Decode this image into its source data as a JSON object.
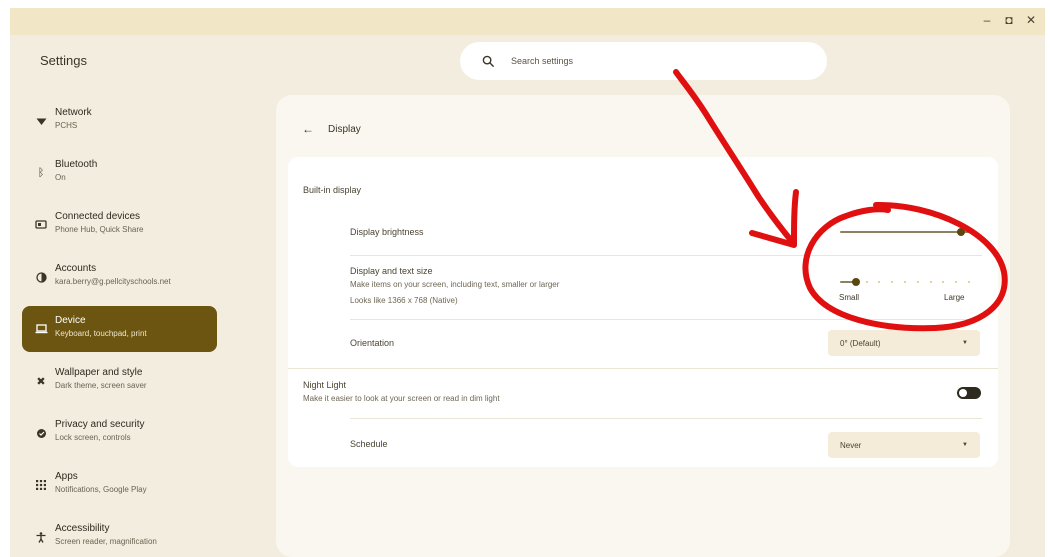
{
  "window": {
    "controls": [
      "–",
      "◘",
      "✕"
    ]
  },
  "app": {
    "title": "Settings"
  },
  "search": {
    "placeholder": "Search settings"
  },
  "sidebar": {
    "items": [
      {
        "label": "Network",
        "sub": "PCHS",
        "icon": "wifi-icon"
      },
      {
        "label": "Bluetooth",
        "sub": "On",
        "icon": "bluetooth-icon"
      },
      {
        "label": "Connected devices",
        "sub": "Phone Hub, Quick Share",
        "icon": "devices-icon"
      },
      {
        "label": "Accounts",
        "sub": "kara.berry@g.pellcityschools.net",
        "icon": "account-icon"
      },
      {
        "label": "Device",
        "sub": "Keyboard, touchpad, print",
        "icon": "laptop-icon",
        "active": true
      },
      {
        "label": "Wallpaper and style",
        "sub": "Dark theme, screen saver",
        "icon": "palette-icon"
      },
      {
        "label": "Privacy and security",
        "sub": "Lock screen, controls",
        "icon": "shield-icon"
      },
      {
        "label": "Apps",
        "sub": "Notifications, Google Play",
        "icon": "apps-icon"
      },
      {
        "label": "Accessibility",
        "sub": "Screen reader, magnification",
        "icon": "accessibility-icon"
      }
    ]
  },
  "page": {
    "title": "Display",
    "built_in": {
      "section": "Built-in display",
      "brightness": {
        "label": "Display brightness",
        "level": 0.96
      },
      "size": {
        "label": "Display and text size",
        "desc": "Make items on your screen, including text, smaller or larger",
        "native": "Looks like 1366 x 768 (Native)",
        "min_label": "Small",
        "max_label": "Large",
        "level": 0.1
      },
      "orientation": {
        "label": "Orientation",
        "value": "0° (Default)"
      }
    },
    "night_light": {
      "label": "Night Light",
      "desc": "Make it easier to look at your screen or read in dim light",
      "enabled": false,
      "schedule_label": "Schedule",
      "schedule_value": "Never"
    }
  },
  "colors": {
    "accent": "#6b5510",
    "window_bg": "#f3ede0",
    "titlebar": "#f1e6c5",
    "annotation": "#e01010"
  }
}
